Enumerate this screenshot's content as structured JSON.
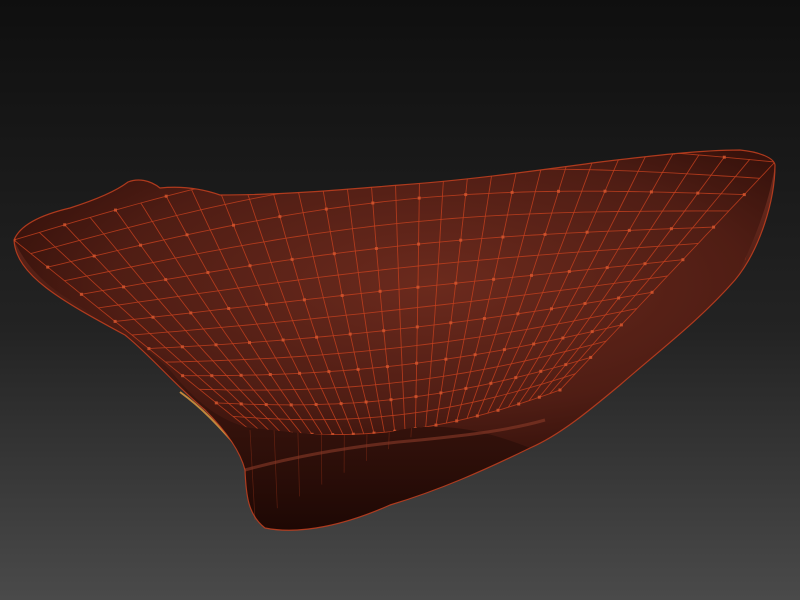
{
  "viewport": {
    "background_top": "#0f0f0f",
    "background_mid": "#232323",
    "background_bottom": "#4a4a4a"
  },
  "mesh": {
    "object": "sculpted-cushion-mesh",
    "surface_color": "#5a2218",
    "surface_highlight": "#7a3426",
    "surface_shadow": "#2a0c07",
    "wire_color": "#c4401e",
    "vertex_color": "#d2552e",
    "rim_highlight_color": "#e8a040",
    "polyframe_visible": true
  }
}
